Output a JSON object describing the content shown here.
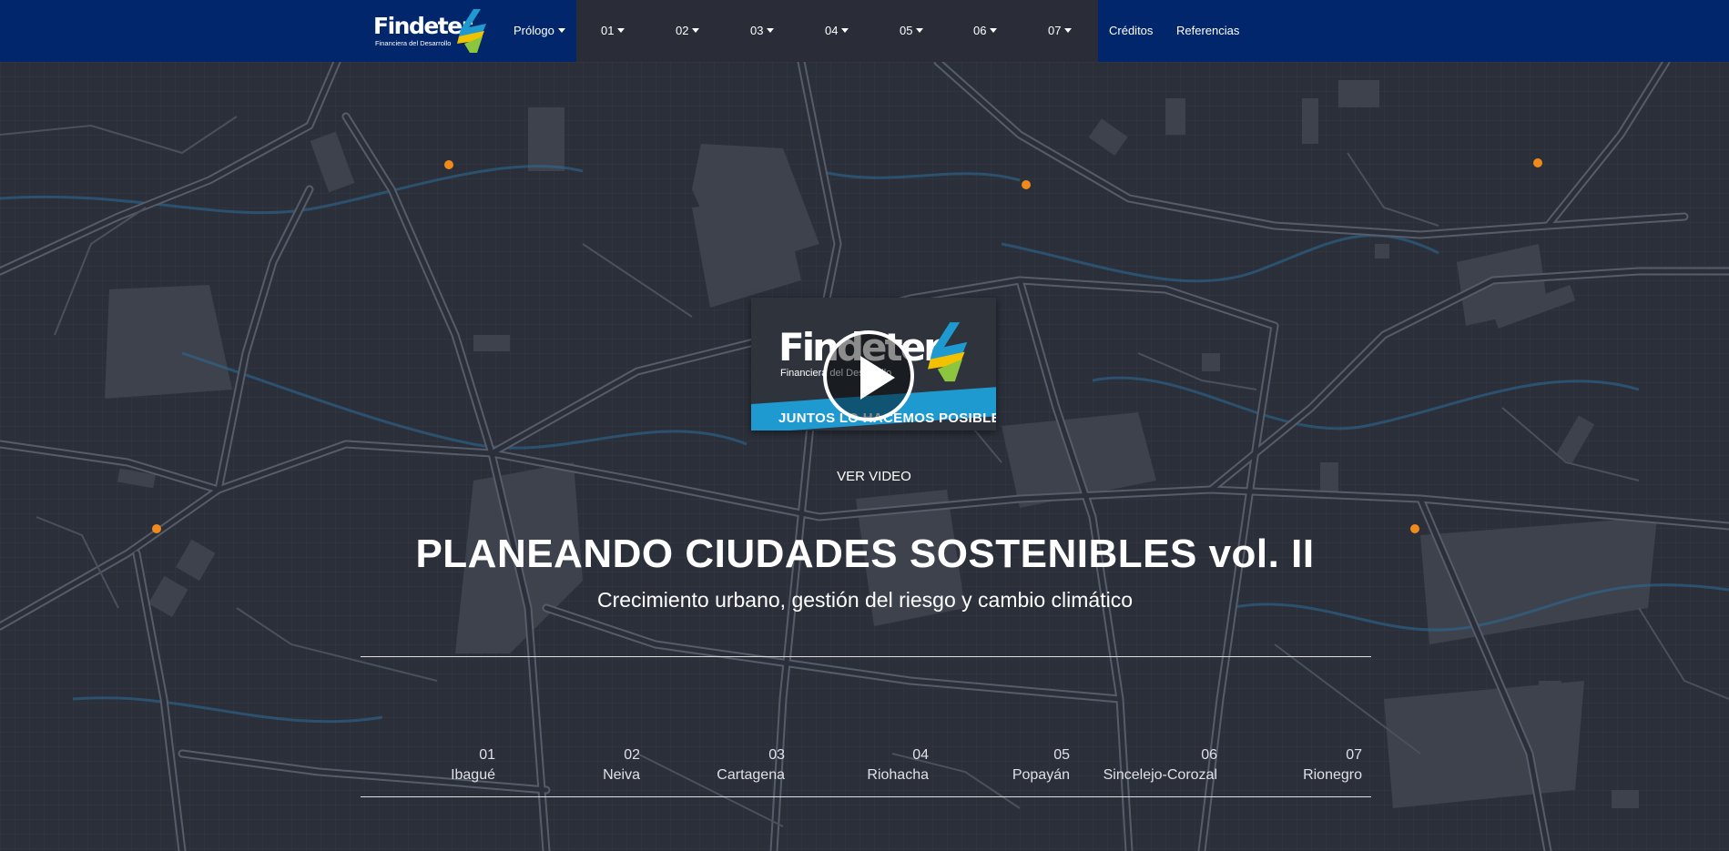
{
  "nav": {
    "brand": {
      "name": "Findeter",
      "tagline": "Financiera del Desarrollo"
    },
    "items": [
      {
        "label": "Prólogo",
        "dropdown": true
      },
      {
        "label": "01",
        "dropdown": true
      },
      {
        "label": "02",
        "dropdown": true
      },
      {
        "label": "03",
        "dropdown": true
      },
      {
        "label": "04",
        "dropdown": true
      },
      {
        "label": "05",
        "dropdown": true
      },
      {
        "label": "06",
        "dropdown": true
      },
      {
        "label": "07",
        "dropdown": true
      },
      {
        "label": "Créditos",
        "dropdown": false
      },
      {
        "label": "Referencias",
        "dropdown": false
      }
    ]
  },
  "video": {
    "thumb_logo": "Findeter",
    "thumb_tagline": "Financiera del Desarrollo",
    "thumb_banner": "JUNTOS LO HACEMOS POSIBLE",
    "play_icon": "play-icon",
    "label": "VER VIDEO"
  },
  "hero": {
    "title": "PLANEANDO CIUDADES SOSTENIBLES vol. II",
    "subtitle": "Crecimiento urbano, gestión del riesgo y cambio climático"
  },
  "cities": [
    {
      "num": "01",
      "name": "Ibagué"
    },
    {
      "num": "02",
      "name": "Neiva"
    },
    {
      "num": "03",
      "name": "Cartagena"
    },
    {
      "num": "04",
      "name": "Riohacha"
    },
    {
      "num": "05",
      "name": "Popayán"
    },
    {
      "num": "06",
      "name": "Sincelejo-Corozal"
    },
    {
      "num": "07",
      "name": "Rionegro"
    }
  ],
  "colors": {
    "navbar": "#01266b",
    "nav_dark_band": "#2a2d37",
    "background": "#2b2f39",
    "map_road": "#5b6170",
    "map_river": "#2b6d9a",
    "map_dot": "#f08a1c",
    "accent_blue": "#1e9ad1",
    "accent_green": "#8cc63e"
  }
}
